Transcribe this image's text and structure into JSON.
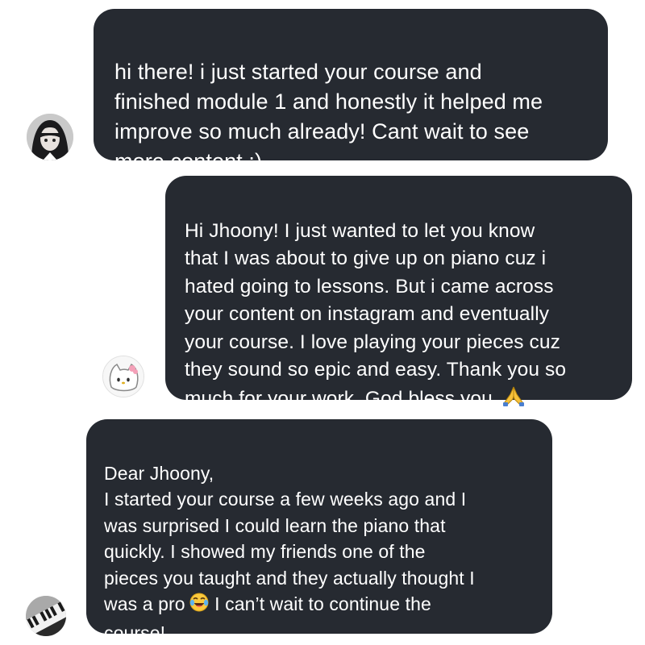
{
  "messages": [
    {
      "text": "hi there! i just started your course and\nfinished module 1 and honestly it helped me\nimprove so much already! Cant wait to see\nmore content :)"
    },
    {
      "text": "Hi Jhoony! I just wanted to let you know\nthat I was about to give up on piano cuz i\nhated going to lessons. But i came across\nyour content on instagram and eventually\nyour course. I love playing your pieces cuz\nthey sound so epic and easy. Thank you so\nmuch for your work. God bless you.",
      "emoji": "folded-hands-emoji"
    },
    {
      "text_before": "Dear Jhoony,\nI started your course a few weeks ago and I\nwas surprised I could learn the piano that\nquickly. I showed my friends one of the\npieces you taught and they actually thought I\nwas a pro",
      "emoji": "laughing-tears-emoji",
      "text_after": " I can’t wait to continue the\ncourse!"
    }
  ],
  "avatars": [
    "dark-haired-avatar",
    "cat-avatar",
    "piano-avatar"
  ],
  "colors": {
    "bubble": "#262a31",
    "text": "#ffffff",
    "background": "#ffffff"
  }
}
